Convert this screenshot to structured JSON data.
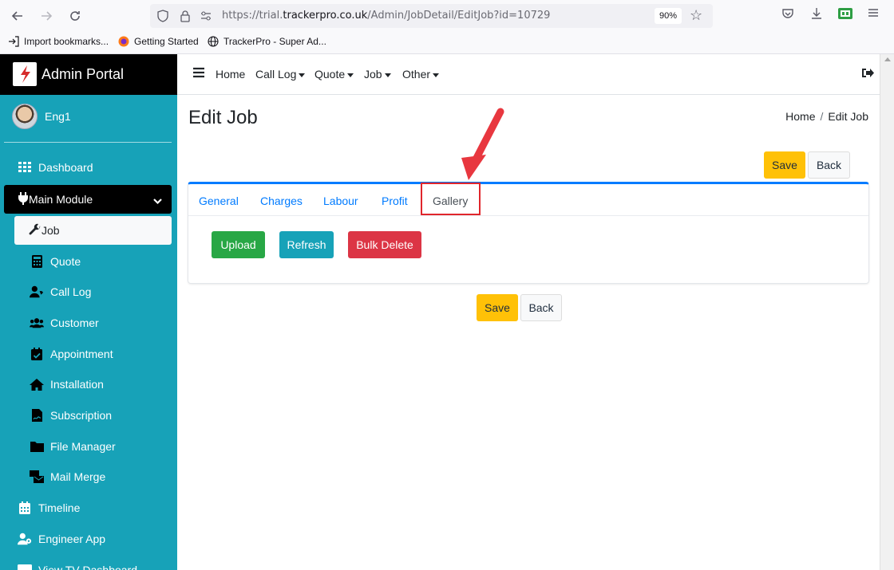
{
  "browser": {
    "url_prefix": "https://trial.",
    "url_domain": "trackerpro.co.uk",
    "url_path": "/Admin/JobDetail/EditJob?id=10729",
    "zoom": "90%",
    "bookmarks": [
      {
        "label": "Import bookmarks..."
      },
      {
        "label": "Getting Started"
      },
      {
        "label": "TrackerPro - Super Ad..."
      }
    ]
  },
  "sidebar": {
    "brand": "Admin Portal",
    "user": "Eng1",
    "items": [
      {
        "label": "Dashboard"
      },
      {
        "label": "Main Module"
      },
      {
        "label": "Job"
      },
      {
        "label": "Quote"
      },
      {
        "label": "Call Log"
      },
      {
        "label": "Customer"
      },
      {
        "label": "Appointment"
      },
      {
        "label": "Installation"
      },
      {
        "label": "Subscription"
      },
      {
        "label": "File Manager"
      },
      {
        "label": "Mail Merge"
      },
      {
        "label": "Timeline"
      },
      {
        "label": "Engineer App"
      },
      {
        "label": "View TV Dashboard"
      }
    ]
  },
  "topnav": {
    "items": [
      {
        "label": "Home"
      },
      {
        "label": "Call Log"
      },
      {
        "label": "Quote"
      },
      {
        "label": "Job"
      },
      {
        "label": "Other"
      }
    ]
  },
  "page": {
    "title": "Edit Job",
    "breadcrumb_home": "Home",
    "breadcrumb_separator": "/",
    "breadcrumb_current": "Edit Job",
    "save_label": "Save",
    "back_label": "Back"
  },
  "tabs": [
    {
      "label": "General"
    },
    {
      "label": "Charges"
    },
    {
      "label": "Labour"
    },
    {
      "label": "Profit"
    },
    {
      "label": "Gallery"
    }
  ],
  "gallery": {
    "upload_label": "Upload",
    "refresh_label": "Refresh",
    "bulk_delete_label": "Bulk Delete"
  },
  "colors": {
    "sidebar": "#17a2b8",
    "brand_bg": "#000000",
    "warning": "#ffc107",
    "success": "#28a745",
    "danger": "#dc3545",
    "primary": "#007bff",
    "annotation": "#e0262c"
  }
}
